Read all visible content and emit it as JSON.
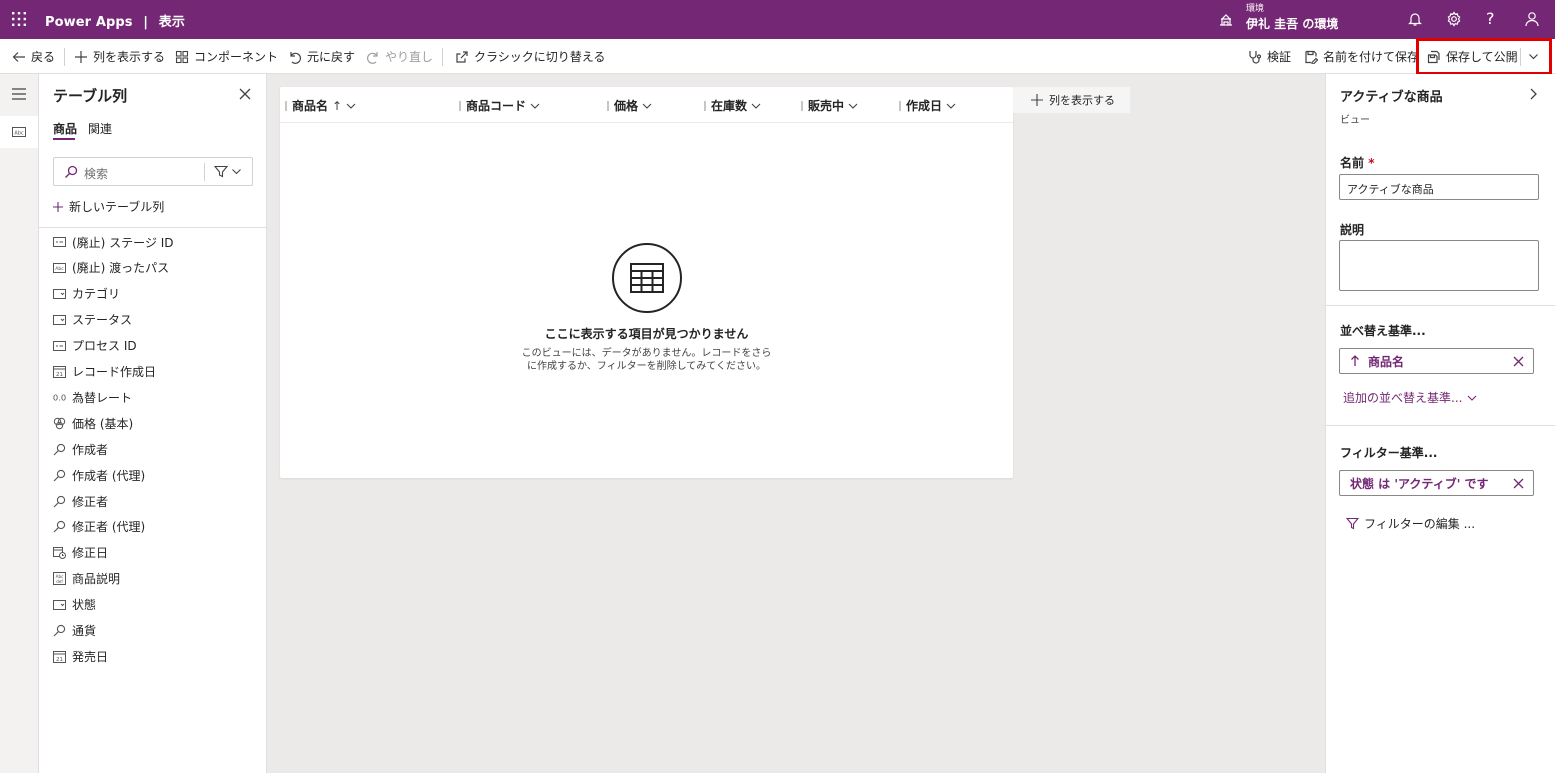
{
  "topbar": {
    "app_name": "Power Apps",
    "separator": "|",
    "page": "表示",
    "env_label": "環境",
    "env_name": "伊礼 圭吾 の環境",
    "bg_color": "#742774"
  },
  "cmdbar": {
    "back": "戻る",
    "show_column": "列を表示する",
    "component": "コンポーネント",
    "undo": "元に戻す",
    "redo": "やり直し",
    "classic": "クラシックに切り替える",
    "validate": "検証",
    "save_as": "名前を付けて保存",
    "save_publish": "保存して公開"
  },
  "columns_pane": {
    "title": "テーブル列",
    "tabs": [
      "商品",
      "関連"
    ],
    "search_placeholder": "検索",
    "new_column": "新しいテーブル列",
    "fields": [
      {
        "label": "(廃止) ステージ ID",
        "icon": "id-field-icon"
      },
      {
        "label": "(廃止) 渡ったパス",
        "icon": "text-field-icon"
      },
      {
        "label": "カテゴリ",
        "icon": "lookup-field-icon"
      },
      {
        "label": "ステータス",
        "icon": "choice-field-icon"
      },
      {
        "label": "プロセス ID",
        "icon": "id-field-icon"
      },
      {
        "label": "レコード作成日",
        "icon": "calendar-icon"
      },
      {
        "label": "為替レート",
        "icon": "decimal-icon"
      },
      {
        "label": "価格 (基本)",
        "icon": "currency-icon"
      },
      {
        "label": "作成者",
        "icon": "search-lookup-icon"
      },
      {
        "label": "作成者 (代理)",
        "icon": "search-lookup-icon"
      },
      {
        "label": "修正者",
        "icon": "search-lookup-icon"
      },
      {
        "label": "修正者 (代理)",
        "icon": "search-lookup-icon"
      },
      {
        "label": "修正日",
        "icon": "calendar-clock-icon"
      },
      {
        "label": "商品説明",
        "icon": "multiline-text-icon"
      },
      {
        "label": "状態",
        "icon": "choice-field-icon"
      },
      {
        "label": "通貨",
        "icon": "search-lookup-icon"
      },
      {
        "label": "発売日",
        "icon": "calendar-icon"
      }
    ]
  },
  "grid": {
    "columns": [
      "商品名",
      "商品コード",
      "価格",
      "在庫数",
      "販売中",
      "作成日"
    ],
    "sort_indicator": "↑",
    "empty_title": "ここに表示する項目が見つかりません",
    "empty_desc": "このビューには、データがありません。レコードをさらに作成するか、フィルターを削除してみてください。",
    "add_column": "列を表示する"
  },
  "right_pane": {
    "view_title": "アクティブな商品",
    "view_subtitle": "ビュー",
    "name_label": "名前",
    "required_mark": "*",
    "name_value": "アクティブな商品",
    "desc_label": "説明",
    "sort_label": "並べ替え基準...",
    "sort_chip": "商品名",
    "add_sort": "追加の並べ替え基準...",
    "filter_label": "フィルター基準...",
    "filter_chip": "状態 は 'アクティブ' です",
    "edit_filter": "フィルターの編集 ..."
  }
}
